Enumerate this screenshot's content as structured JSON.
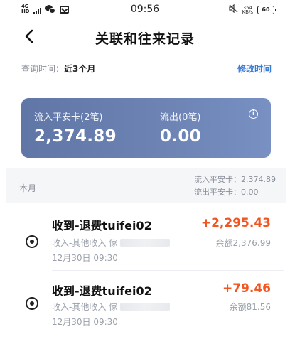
{
  "status_bar": {
    "signal_text": "4G HD",
    "time": "09:56",
    "net_speed_value": "354",
    "net_speed_unit": "KB/s",
    "battery": "60"
  },
  "nav": {
    "title": "关联和往来记录"
  },
  "query": {
    "label": "查询时间：",
    "value": "近3个月",
    "modify_label": "修改时间"
  },
  "summary": {
    "inflow_label": "流入平安卡(2笔)",
    "inflow_value": "2,374.89",
    "outflow_label": "流出(0笔)",
    "outflow_value": "0.00"
  },
  "month": {
    "label": "本月",
    "inflow_summary": "流入平安卡：2,374.89",
    "outflow_summary": "流出平安卡：0.00"
  },
  "transactions": [
    {
      "title": "收到-退费tuifei02",
      "amount": "+2,295.43",
      "category": "收入-其他收入 傢",
      "balance": "余额2,376.99",
      "date": "12月30日 09:30"
    },
    {
      "title": "收到-退费tuifei02",
      "amount": "+79.46",
      "category": "收入-其他收入 傢",
      "balance": "余额81.56",
      "date": "12月30日 09:30"
    }
  ],
  "colors": {
    "accent_blue": "#3a7bd5",
    "card_bg": "#6d84b5",
    "income_orange": "#f2551f"
  }
}
